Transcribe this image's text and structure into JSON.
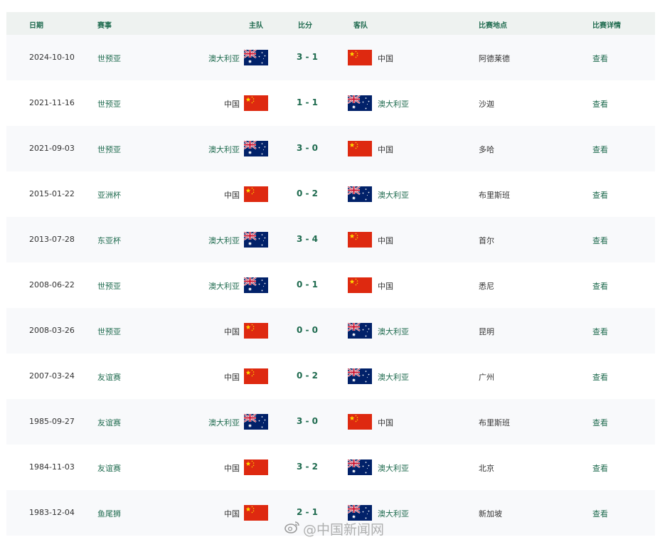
{
  "header": {
    "date": "日期",
    "competition": "赛事",
    "home": "主队",
    "score": "比分",
    "away": "客队",
    "venue": "比赛地点",
    "detail": "比赛详情"
  },
  "rows": [
    {
      "date": "2024-10-10",
      "competition": "世预亚",
      "home": "澳大利亚",
      "home_flag": "australia-flag",
      "score": "3 - 1",
      "away": "中国",
      "away_flag": "china-flag",
      "venue": "阿德莱德",
      "detail": "查看"
    },
    {
      "date": "2021-11-16",
      "competition": "世预亚",
      "home": "中国",
      "home_flag": "china-flag",
      "score": "1 - 1",
      "away": "澳大利亚",
      "away_flag": "australia-flag",
      "venue": "沙迦",
      "detail": "查看"
    },
    {
      "date": "2021-09-03",
      "competition": "世预亚",
      "home": "澳大利亚",
      "home_flag": "australia-flag",
      "score": "3 - 0",
      "away": "中国",
      "away_flag": "china-flag",
      "venue": "多哈",
      "detail": "查看"
    },
    {
      "date": "2015-01-22",
      "competition": "亚洲杯",
      "home": "中国",
      "home_flag": "china-flag",
      "score": "0 - 2",
      "away": "澳大利亚",
      "away_flag": "australia-flag",
      "venue": "布里斯班",
      "detail": "查看"
    },
    {
      "date": "2013-07-28",
      "competition": "东亚杯",
      "home": "澳大利亚",
      "home_flag": "australia-flag",
      "score": "3 - 4",
      "away": "中国",
      "away_flag": "china-flag",
      "venue": "首尔",
      "detail": "查看"
    },
    {
      "date": "2008-06-22",
      "competition": "世预亚",
      "home": "澳大利亚",
      "home_flag": "australia-flag",
      "score": "0 - 1",
      "away": "中国",
      "away_flag": "china-flag",
      "venue": "悉尼",
      "detail": "查看"
    },
    {
      "date": "2008-03-26",
      "competition": "世预亚",
      "home": "中国",
      "home_flag": "china-flag",
      "score": "0 - 0",
      "away": "澳大利亚",
      "away_flag": "australia-flag",
      "venue": "昆明",
      "detail": "查看"
    },
    {
      "date": "2007-03-24",
      "competition": "友谊赛",
      "home": "中国",
      "home_flag": "china-flag",
      "score": "0 - 2",
      "away": "澳大利亚",
      "away_flag": "australia-flag",
      "venue": "广州",
      "detail": "查看"
    },
    {
      "date": "1985-09-27",
      "competition": "友谊赛",
      "home": "澳大利亚",
      "home_flag": "australia-flag",
      "score": "3 - 0",
      "away": "中国",
      "away_flag": "china-flag",
      "venue": "布里斯班",
      "detail": "查看"
    },
    {
      "date": "1984-11-03",
      "competition": "友谊赛",
      "home": "中国",
      "home_flag": "china-flag",
      "score": "3 - 2",
      "away": "澳大利亚",
      "away_flag": "australia-flag",
      "venue": "北京",
      "detail": "查看"
    },
    {
      "date": "1983-12-04",
      "competition": "鱼尾狮",
      "home": "中国",
      "home_flag": "china-flag",
      "score": "2 - 1",
      "away": "澳大利亚",
      "away_flag": "australia-flag",
      "venue": "新加坡",
      "detail": "查看"
    }
  ],
  "watermark": {
    "text": "@中国新闻网",
    "icon": "weibo-icon"
  },
  "colors": {
    "accent": "#1f6b4f",
    "header_bg": "#eef2f0",
    "row_alt_bg": "#f8f9fb",
    "china_red": "#de2910",
    "china_star": "#ffde00",
    "australia_blue": "#012169"
  }
}
